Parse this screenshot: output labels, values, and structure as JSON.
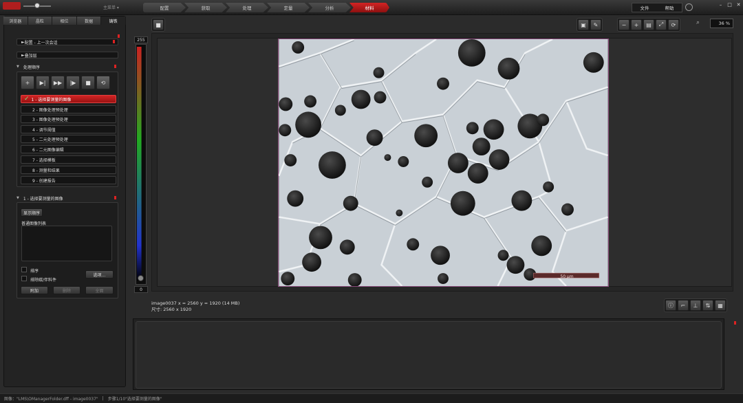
{
  "topbar": {
    "mode_label": "主菜单 ▾",
    "workflow_steps": [
      "配置",
      "获取",
      "处理",
      "定量",
      "分析",
      "材料"
    ],
    "active_step": 5,
    "menu": [
      "文件",
      "帮助"
    ],
    "window_controls": [
      "–",
      "□",
      "✕"
    ]
  },
  "left_panel": {
    "tabs": [
      "浏览器",
      "晶粒",
      "相位",
      "数据",
      "铸铁"
    ],
    "active_tab": 4,
    "config_label": "配置 - 上一次会话",
    "overlay_label": "叠加层",
    "procedure_label": "处理顺序",
    "toolbar_icons": [
      "add-step-icon",
      "step-forward-icon",
      "fast-forward-icon",
      "skip-icon",
      "stop-icon",
      "loop-icon"
    ],
    "toolbar_glyphs": [
      "+",
      "▶|",
      "▶▶",
      "|▶",
      "■",
      "⟲"
    ],
    "steps": [
      "1 - 选择要测量的图像",
      "2 - 图像处理预处理",
      "3 - 图像处理预处理",
      "4 - 调节阈值",
      "5 - 二元处理预处理",
      "6 - 二元图像编辑",
      "7 - 选择模板",
      "8 - 测量和结果",
      "9 - 创建报告"
    ],
    "active_step_index": 0,
    "selection_header": "1 - 选择要测量的图像",
    "show_sequence_button": "显示顺序",
    "list_label": "普通图像列表",
    "sort_label": "排序",
    "exclude_label": "排除碳/伴料件",
    "more_button": "选项...",
    "add_button": "附加",
    "delete_button": "删除",
    "all_button": "全面"
  },
  "histogram": {
    "max": "255",
    "min": "0"
  },
  "viewer": {
    "zoom": "36 %",
    "scale_bar": "50 μm",
    "info_line1": "image0037   x = 2560 y = 1920  (14 MB)",
    "info_line2": "尺寸: 2560 x 1920"
  },
  "status_bar": {
    "path": "图像：\"LMS\\OManagerFolder.dff - image0037\"",
    "separator": "|",
    "step": "步骤1/10\"选择要测量的图像\""
  }
}
